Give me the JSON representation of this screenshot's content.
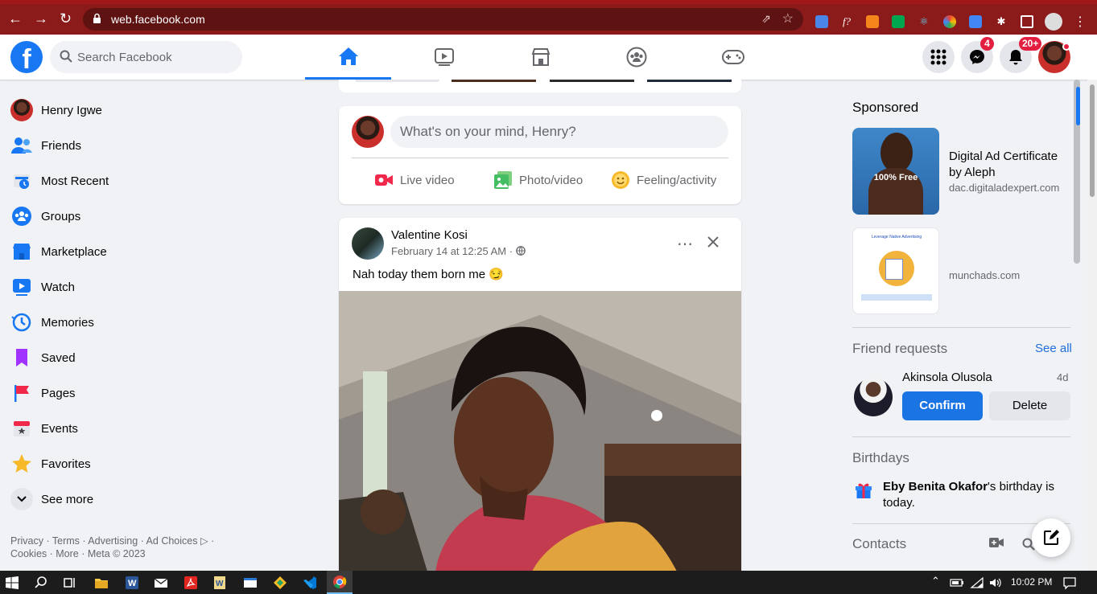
{
  "browser": {
    "url": "web.facebook.com"
  },
  "header": {
    "logo": "f",
    "search_placeholder": "Search Facebook",
    "messenger_badge": "4",
    "notifications_badge": "20+"
  },
  "left_nav": {
    "items": [
      {
        "label": "Henry Igwe",
        "icon": "profile-avatar"
      },
      {
        "label": "Friends",
        "icon": "friends-icon"
      },
      {
        "label": "Most Recent",
        "icon": "most-recent-icon"
      },
      {
        "label": "Groups",
        "icon": "groups-icon"
      },
      {
        "label": "Marketplace",
        "icon": "marketplace-icon"
      },
      {
        "label": "Watch",
        "icon": "watch-icon"
      },
      {
        "label": "Memories",
        "icon": "memories-icon"
      },
      {
        "label": "Saved",
        "icon": "saved-icon"
      },
      {
        "label": "Pages",
        "icon": "pages-icon"
      },
      {
        "label": "Events",
        "icon": "events-icon"
      },
      {
        "label": "Favorites",
        "icon": "favorites-icon"
      },
      {
        "label": "See more",
        "icon": "chevron-down-icon"
      }
    ],
    "footer_line1": "Privacy · Terms · Advertising · Ad Choices ▷ ·",
    "footer_line2": "Cookies · More · Meta © 2023"
  },
  "create_post": {
    "placeholder": "What's on your mind, Henry?",
    "actions": [
      "Live video",
      "Photo/video",
      "Feeling/activity"
    ]
  },
  "post": {
    "author": "Valentine Kosi",
    "timestamp": "February 14 at 12:25 AM ·",
    "text": "Nah today them born me 😏"
  },
  "right": {
    "sponsored_title": "Sponsored",
    "ads": [
      {
        "title": "Digital Ad Certificate by Aleph",
        "domain": "dac.digitaladexpert.com",
        "thumb_text": "100% Free"
      },
      {
        "title": "",
        "domain": "munchads.com",
        "thumb_text": "Leverage Native Advertising"
      }
    ],
    "friend_requests_title": "Friend requests",
    "see_all": "See all",
    "request": {
      "name": "Akinsola Olusola",
      "age": "4d",
      "confirm": "Confirm",
      "delete": "Delete"
    },
    "birthdays_title": "Birthdays",
    "birthday_name": "Eby Benita Okafor",
    "birthday_rest": "'s birthday is today.",
    "contacts_title": "Contacts"
  },
  "taskbar": {
    "clock": "10:02 PM"
  },
  "colors": {
    "browser_red": "#8b1a1a",
    "fb_blue": "#1877f2",
    "badge_red": "#e41e3f"
  }
}
